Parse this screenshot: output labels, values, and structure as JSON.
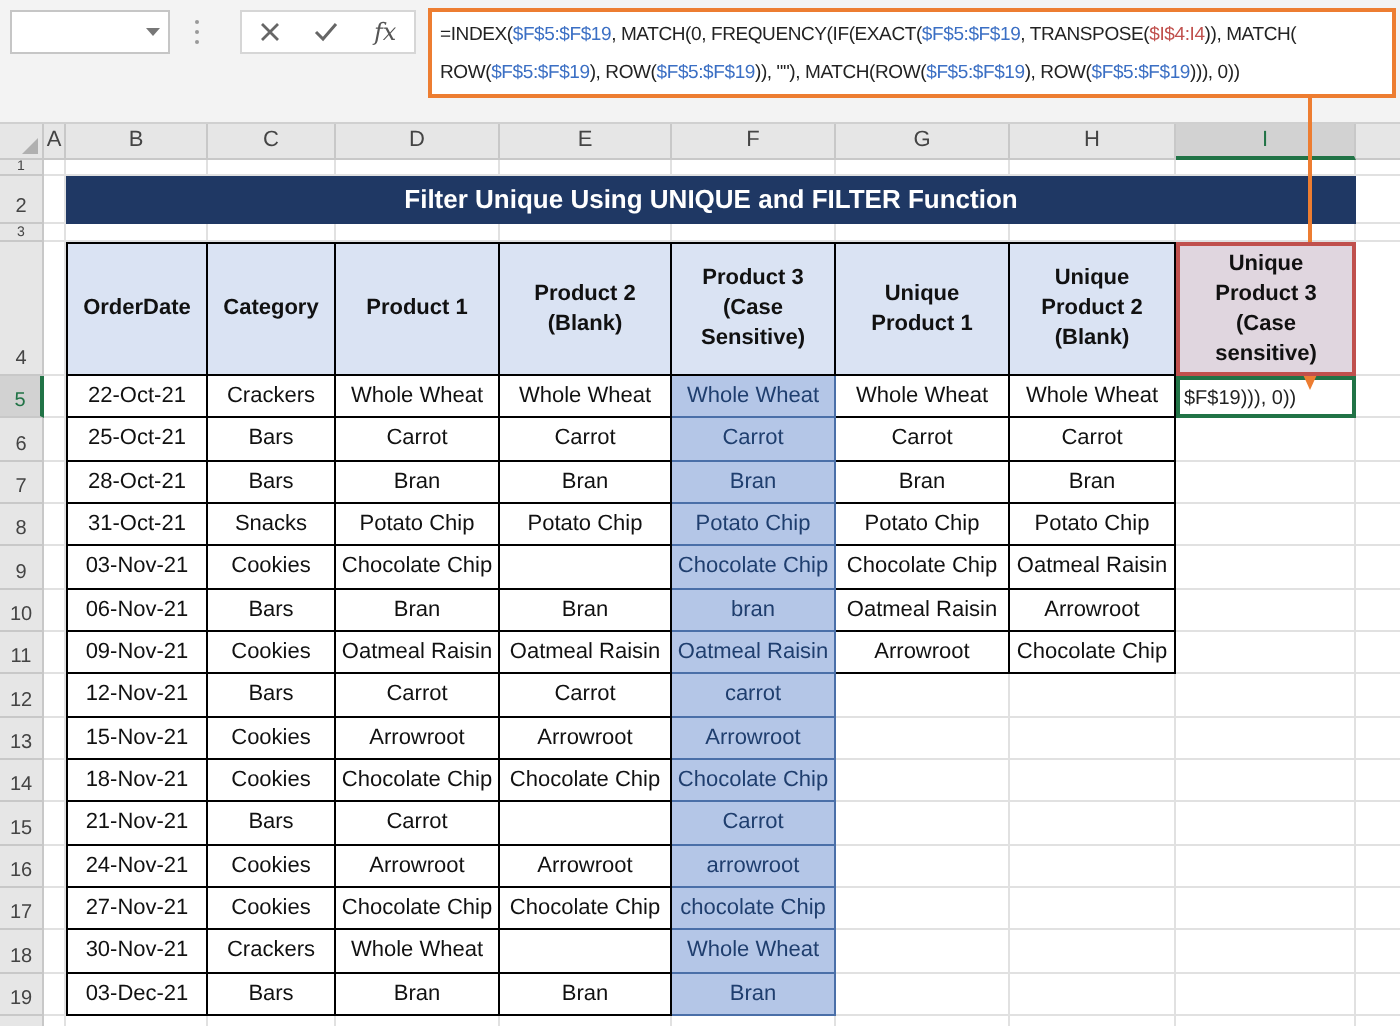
{
  "formula_bar": {
    "fx": "fx",
    "lines": [
      [
        {
          "text": "=INDEX(",
          "color": "#222222"
        },
        {
          "text": "$F$5:$F$19",
          "color": "#3b6fc4"
        },
        {
          "text": ", MATCH(0, FREQUENCY(IF(EXACT(",
          "color": "#222222"
        },
        {
          "text": "$F$5:$F$19",
          "color": "#3b6fc4"
        },
        {
          "text": ", TRANSPOSE(",
          "color": "#222222"
        },
        {
          "text": "$I$4:I4",
          "color": "#c0504d"
        },
        {
          "text": ")), MATCH(",
          "color": "#222222"
        }
      ],
      [
        {
          "text": "ROW(",
          "color": "#222222"
        },
        {
          "text": "$F$5:$F$19",
          "color": "#3b6fc4"
        },
        {
          "text": "), ROW(",
          "color": "#222222"
        },
        {
          "text": "$F$5:$F$19",
          "color": "#3b6fc4"
        },
        {
          "text": ")), \"\"), MATCH(ROW(",
          "color": "#222222"
        },
        {
          "text": "$F$5:$F$19",
          "color": "#3b6fc4"
        },
        {
          "text": "), ROW(",
          "color": "#222222"
        },
        {
          "text": "$F$5:$F$19",
          "color": "#3b6fc4"
        },
        {
          "text": "))), 0))",
          "color": "#222222"
        }
      ]
    ]
  },
  "column_headers": [
    {
      "label": "A",
      "selected": false
    },
    {
      "label": "B",
      "selected": false
    },
    {
      "label": "C",
      "selected": false
    },
    {
      "label": "D",
      "selected": false
    },
    {
      "label": "E",
      "selected": false
    },
    {
      "label": "F",
      "selected": false
    },
    {
      "label": "G",
      "selected": false
    },
    {
      "label": "H",
      "selected": false
    },
    {
      "label": "I",
      "selected": true
    }
  ],
  "row_headers": [
    {
      "label": "1",
      "selected": false
    },
    {
      "label": "2",
      "selected": false
    },
    {
      "label": "3",
      "selected": false
    },
    {
      "label": "4",
      "selected": false
    },
    {
      "label": "5",
      "selected": true
    },
    {
      "label": "6",
      "selected": false
    },
    {
      "label": "7",
      "selected": false
    },
    {
      "label": "8",
      "selected": false
    },
    {
      "label": "9",
      "selected": false
    },
    {
      "label": "10",
      "selected": false
    },
    {
      "label": "11",
      "selected": false
    },
    {
      "label": "12",
      "selected": false
    },
    {
      "label": "13",
      "selected": false
    },
    {
      "label": "14",
      "selected": false
    },
    {
      "label": "15",
      "selected": false
    },
    {
      "label": "16",
      "selected": false
    },
    {
      "label": "17",
      "selected": false
    },
    {
      "label": "18",
      "selected": false
    },
    {
      "label": "19",
      "selected": false
    }
  ],
  "title": "Filter Unique Using UNIQUE and FILTER Function",
  "table": {
    "columns": [
      {
        "label": "OrderDate",
        "highlighted": false,
        "selected": false
      },
      {
        "label": "Category",
        "highlighted": false,
        "selected": false
      },
      {
        "label": "Product 1",
        "highlighted": false,
        "selected": false
      },
      {
        "label": "Product 2 (Blank)",
        "highlighted": false,
        "selected": false
      },
      {
        "label": "Product 3 (Case Sensitive)",
        "highlighted": true,
        "selected": false
      },
      {
        "label": "Unique Product 1",
        "highlighted": false,
        "selected": false
      },
      {
        "label": "Unique Product 2 (Blank)",
        "highlighted": false,
        "selected": false
      },
      {
        "label": "Unique Product 3 (Case sensitive)",
        "highlighted": false,
        "selected": true
      }
    ],
    "rows": [
      [
        "22-Oct-21",
        "Crackers",
        "Whole Wheat",
        "Whole Wheat",
        "Whole Wheat"
      ],
      [
        "25-Oct-21",
        "Bars",
        "Carrot",
        "Carrot",
        "Carrot"
      ],
      [
        "28-Oct-21",
        "Bars",
        "Bran",
        "Bran",
        "Bran"
      ],
      [
        "31-Oct-21",
        "Snacks",
        "Potato Chip",
        "Potato Chip",
        "Potato Chip"
      ],
      [
        "03-Nov-21",
        "Cookies",
        "Chocolate Chip",
        null,
        "Chocolate Chip"
      ],
      [
        "06-Nov-21",
        "Bars",
        "Bran",
        "Bran",
        "bran"
      ],
      [
        "09-Nov-21",
        "Cookies",
        "Oatmeal Raisin",
        "Oatmeal Raisin",
        "Oatmeal Raisin"
      ],
      [
        "12-Nov-21",
        "Bars",
        "Carrot",
        "Carrot",
        "carrot"
      ],
      [
        "15-Nov-21",
        "Cookies",
        "Arrowroot",
        "Arrowroot",
        "Arrowroot"
      ],
      [
        "18-Nov-21",
        "Cookies",
        "Chocolate Chip",
        "Chocolate Chip",
        "Chocolate Chip"
      ],
      [
        "21-Nov-21",
        "Bars",
        "Carrot",
        null,
        "Carrot"
      ],
      [
        "24-Nov-21",
        "Cookies",
        "Arrowroot",
        "Arrowroot",
        "arrowroot"
      ],
      [
        "27-Nov-21",
        "Cookies",
        "Chocolate Chip",
        "Chocolate Chip",
        "chocolate Chip"
      ],
      [
        "30-Nov-21",
        "Crackers",
        "Whole Wheat",
        null,
        "Whole Wheat"
      ],
      [
        "03-Dec-21",
        "Bars",
        "Bran",
        "Bran",
        "Bran"
      ]
    ],
    "unique_rows": [
      [
        "Whole Wheat",
        "Whole Wheat"
      ],
      [
        "Carrot",
        "Carrot"
      ],
      [
        "Bran",
        "Bran"
      ],
      [
        "Potato Chip",
        "Potato Chip"
      ],
      [
        "Chocolate Chip",
        "Oatmeal Raisin"
      ],
      [
        "Oatmeal Raisin",
        "Arrowroot"
      ],
      [
        "Arrowroot",
        "Chocolate Chip"
      ]
    ],
    "active_cell": {
      "value": "$F$19))), 0))"
    }
  }
}
